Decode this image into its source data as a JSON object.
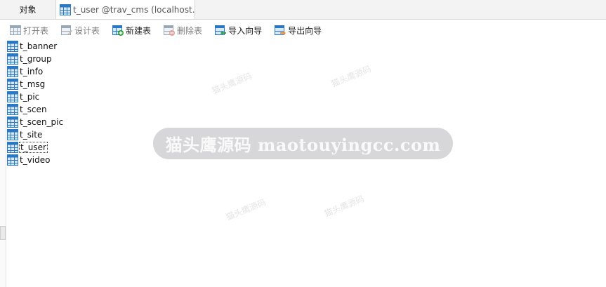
{
  "tabs": [
    {
      "label": "对象"
    },
    {
      "label": "t_user @trav_cms (localhost..."
    }
  ],
  "toolbar": {
    "open_table": "打开表",
    "design_table": "设计表",
    "new_table": "新建表",
    "delete_table": "删除表",
    "import_wizard": "导入向导",
    "export_wizard": "导出向导"
  },
  "tables": [
    "t_banner",
    "t_group",
    "t_info",
    "t_msg",
    "t_pic",
    "t_scen",
    "t_scen_pic",
    "t_site",
    "t_user",
    "t_video"
  ],
  "selected_table": "t_user",
  "watermark": {
    "banner": "猫头鹰源码 maotouyingcc.com",
    "tile": "猫头鹰源码"
  },
  "colors": {
    "table_icon_blue": "#2b78c2",
    "table_icon_grid": "#d8e8f7",
    "add_green": "#2f9e3a",
    "delete_red": "#d9534f",
    "arrow_orange": "#e8892c"
  }
}
